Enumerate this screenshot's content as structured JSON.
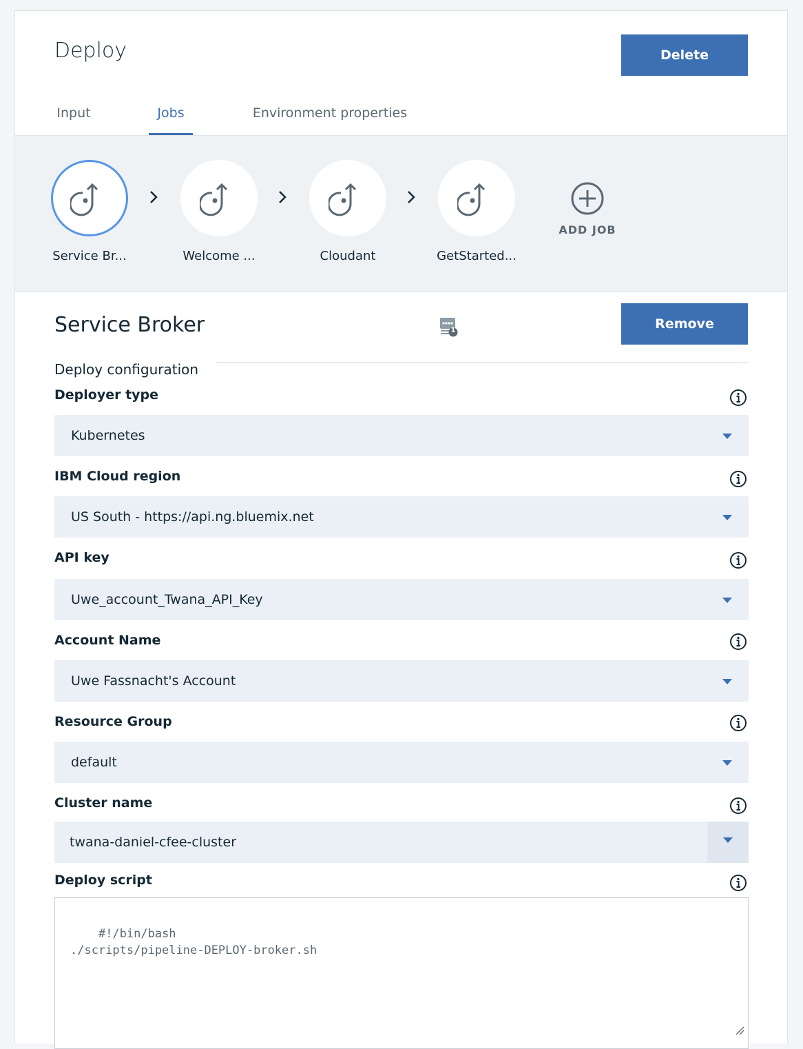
{
  "header": {
    "title": "Deploy",
    "delete_label": "Delete"
  },
  "tabs": [
    {
      "label": "Input"
    },
    {
      "label": "Jobs",
      "active": true
    },
    {
      "label": "Environment properties"
    }
  ],
  "jobs": [
    {
      "label": "Service Br...",
      "selected": true,
      "icon": "deploy-job-icon"
    },
    {
      "label": "Welcome ...",
      "icon": "deploy-job-icon"
    },
    {
      "label": "Cloudant",
      "icon": "deploy-job-icon"
    },
    {
      "label": "GetStarted...",
      "icon": "deploy-job-icon"
    }
  ],
  "add_job_label": "ADD JOB",
  "job_detail": {
    "title": "Service Broker",
    "badge_icon": "job-config-icon",
    "badge_count": "1",
    "remove_label": "Remove",
    "section_label": "Deploy configuration"
  },
  "fields": [
    {
      "label": "Deployer type",
      "value": "Kubernetes"
    },
    {
      "label": "IBM Cloud region",
      "value": "US South - https://api.ng.bluemix.net"
    },
    {
      "label": "API key",
      "value": "Uwe_account_Twana_API_Key"
    },
    {
      "label": "Account Name",
      "value": "Uwe Fassnacht's Account"
    },
    {
      "label": "Resource Group",
      "value": "default"
    },
    {
      "label": "Cluster name",
      "value": "twana-daniel-cfee-cluster"
    }
  ],
  "deploy_script": {
    "label": "Deploy script",
    "value": "#!/bin/bash\n./scripts/pipeline-DEPLOY-broker.sh"
  },
  "colors": {
    "accent": "#3d70b2",
    "selected_ring": "#5596e6",
    "field_bg": "#ebf0f7",
    "strip_bg": "#eff2f5"
  }
}
